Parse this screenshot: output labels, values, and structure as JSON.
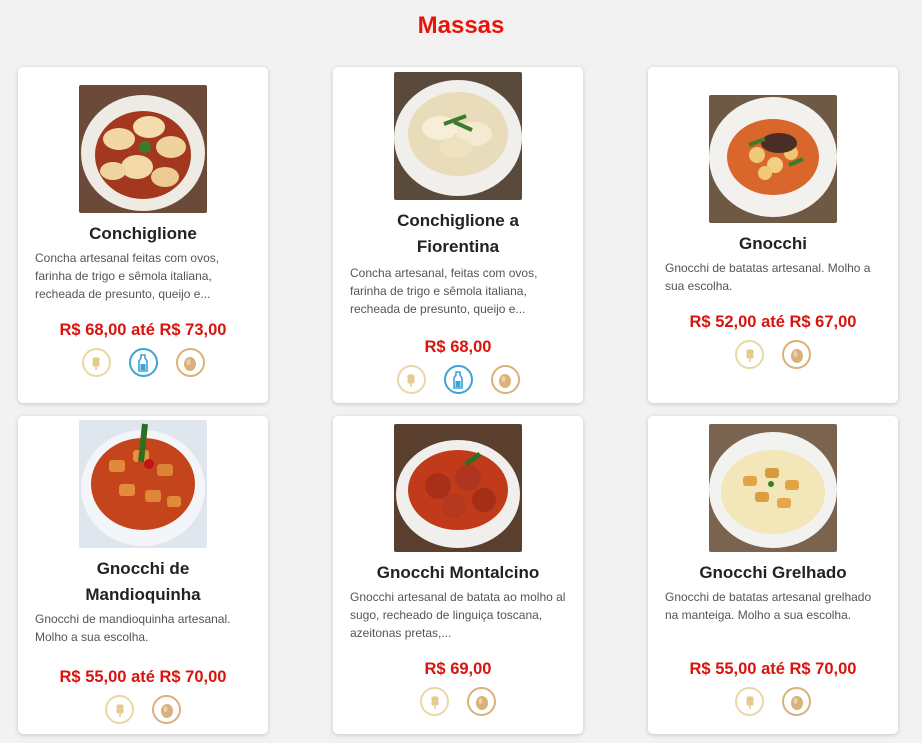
{
  "section_title": "Massas",
  "colors": {
    "accent": "#e8150b",
    "wheat": "#e9d8a6",
    "milk": "#3aa4d9",
    "egg": "#d8b17c"
  },
  "items": [
    {
      "name": "Conchiglione",
      "desc": "Concha artesanal feitas com ovos, farinha de trigo e sêmola italiana, recheada de presunto, queijo e...",
      "price": "R$ 68,00 até R$ 73,00",
      "icons": [
        "wheat-icon",
        "milk-icon",
        "egg-icon"
      ]
    },
    {
      "name": "Conchiglione a Fiorentina",
      "desc": "Concha artesanal, feitas com ovos, farinha de trigo e sêmola italiana, recheada de presunto, queijo e...",
      "price": "R$ 68,00",
      "icons": [
        "wheat-icon",
        "milk-icon",
        "egg-icon"
      ]
    },
    {
      "name": "Gnocchi",
      "desc": "Gnocchi de batatas artesanal. Molho a sua escolha.",
      "price": "R$ 52,00 até R$ 67,00",
      "icons": [
        "wheat-icon",
        "egg-icon"
      ]
    },
    {
      "name": "Gnocchi de Mandioquinha",
      "desc": "Gnocchi de mandioquinha artesanal. Molho a sua escolha.",
      "price": "R$ 55,00 até R$ 70,00",
      "icons": [
        "wheat-icon",
        "egg-icon"
      ]
    },
    {
      "name": "Gnocchi Montalcino",
      "desc": "Gnocchi artesanal de batata ao molho al sugo, recheado de linguiça toscana, azeitonas pretas,...",
      "price": "R$ 69,00",
      "icons": [
        "wheat-icon",
        "egg-icon"
      ]
    },
    {
      "name": "Gnocchi Grelhado",
      "desc": "Gnocchi de batatas artesanal grelhado na manteiga. Molho a sua escolha.",
      "price": "R$ 55,00 até R$ 70,00",
      "icons": [
        "wheat-icon",
        "egg-icon"
      ]
    }
  ]
}
